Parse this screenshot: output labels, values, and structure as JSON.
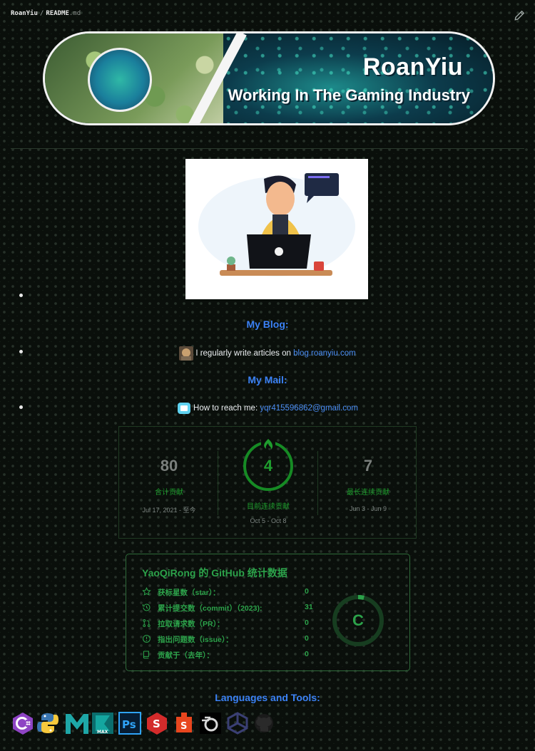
{
  "breadcrumb": {
    "owner": "RoanYiu",
    "separator": "/",
    "file": "README",
    "ext": ".md"
  },
  "banner": {
    "name": "RoanYiu",
    "subtitle": "Working In The Gaming Industry"
  },
  "blog": {
    "heading": "My Blog:",
    "text": "I regularly write articles on",
    "link": "blog.roanyiu.com"
  },
  "mail": {
    "heading": "My Mail:",
    "text": "How to reach me:",
    "link": "yqr415596862@gmail.com"
  },
  "streak": {
    "total": {
      "value": "80",
      "label": "合计贡献",
      "date": "Jul 17, 2021 - 至今"
    },
    "current": {
      "value": "4",
      "label": "目前连续贡献",
      "date": "Oct 5 - Oct 8"
    },
    "longest": {
      "value": "7",
      "label": "最长连续贡献",
      "date": "Jun 3 - Jun 9"
    }
  },
  "stats": {
    "title": "YaoQiRong 的 GitHub 统计数据",
    "rank": "C",
    "rank_progress": 0.04,
    "rows": [
      {
        "icon": "star-icon",
        "label": "获标星数（star）：",
        "value": "0"
      },
      {
        "icon": "history-icon",
        "label": "累计提交数（commit）（2023):",
        "value": "31"
      },
      {
        "icon": "pull-request-icon",
        "label": "拉取请求数（PR）：",
        "value": "0"
      },
      {
        "icon": "issue-icon",
        "label": "指出问题数（issue）：",
        "value": "0"
      },
      {
        "icon": "book-icon",
        "label": "贡献于（去年）：",
        "value": "0"
      }
    ]
  },
  "tools": {
    "heading": "Languages and Tools:",
    "items": [
      "csharp-icon",
      "python-icon",
      "maya-icon",
      "3dsmax-icon",
      "photoshop-icon",
      "substance-painter-icon",
      "substance-designer-icon",
      "blender-icon",
      "unity-icon",
      "github-icon"
    ]
  },
  "colors": {
    "accent": "#3b82f6",
    "streak_green": "#1f9d2e",
    "stats_green": "#2ca24a",
    "link": "#4b8ef5"
  }
}
